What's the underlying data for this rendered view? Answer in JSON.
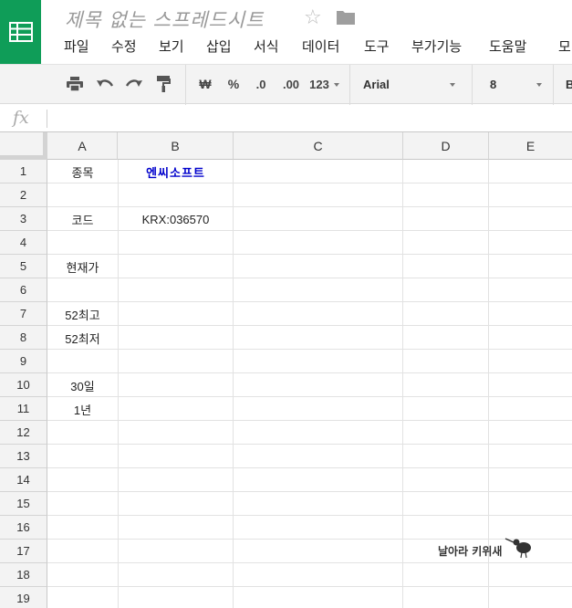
{
  "app": {
    "doc_title": "제목 없는 스프레드시트",
    "brand_color": "#0f9d58"
  },
  "menu": [
    "파일",
    "수정",
    "보기",
    "삽입",
    "서식",
    "데이터",
    "도구",
    "부가기능",
    "도움말",
    "모"
  ],
  "toolbar": {
    "currency_label": "₩",
    "percent_label": "%",
    "decrease_decimal_label": ".0",
    "increase_decimal_label": ".00",
    "more_formats_label": "123",
    "font_family_value": "Arial",
    "font_size_value": "8",
    "next_label": "B"
  },
  "formula_bar": {
    "fx_label": "fx",
    "value": ""
  },
  "columns": [
    "A",
    "B",
    "C",
    "D",
    "E"
  ],
  "rows": [
    "1",
    "2",
    "3",
    "4",
    "5",
    "6",
    "7",
    "8",
    "9",
    "10",
    "11",
    "12",
    "13",
    "14",
    "15",
    "16",
    "17",
    "18",
    "19"
  ],
  "cells": {
    "a1": "종목",
    "b1": "엔씨소프트",
    "a3": "코드",
    "b3": "KRX:036570",
    "a5": "현재가",
    "a7": "52최고",
    "a8": "52최저",
    "a10": "30일",
    "a11": "1년"
  },
  "watermark": {
    "text": "날아라 키위새"
  }
}
